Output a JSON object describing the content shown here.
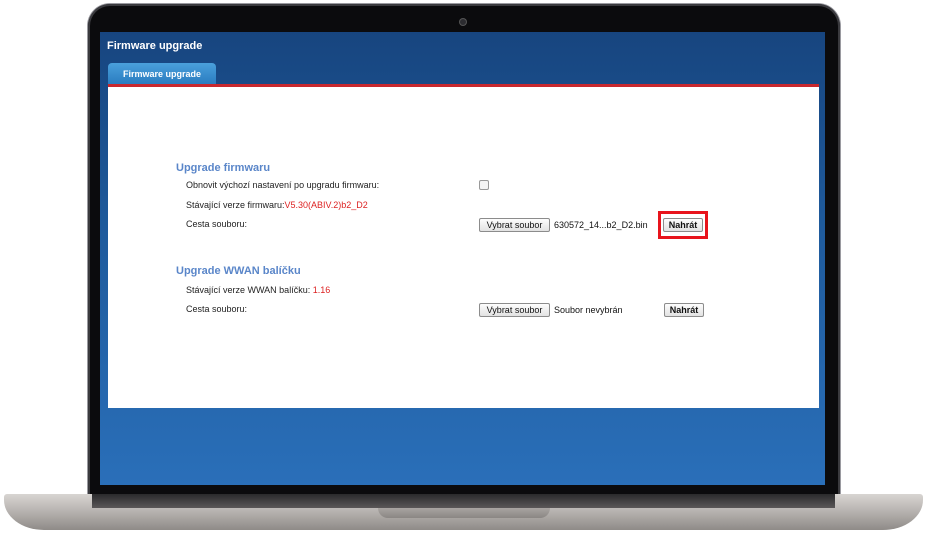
{
  "header": {
    "title": "Firmware upgrade"
  },
  "tabs": [
    {
      "label": "Firmware upgrade",
      "active": true
    }
  ],
  "firmware_section": {
    "title": "Upgrade firmwaru",
    "restore_defaults_label": "Obnovit výchozí nastavení po upgradu firmwaru:",
    "restore_defaults_checked": false,
    "current_version_label": "Stávající verze firmwaru:",
    "current_version_value": "V5.30(ABIV.2)b2_D2",
    "file_path_label": "Cesta souboru:",
    "choose_file_label": "Vybrat soubor",
    "selected_file": "630572_14...b2_D2.bin",
    "upload_label": "Nahrát"
  },
  "wwan_section": {
    "title": "Upgrade WWAN balíčku",
    "current_version_label": "Stávající verze WWAN balíčku:",
    "current_version_value": "1.16",
    "file_path_label": "Cesta souboru:",
    "choose_file_label": "Vybrat soubor",
    "selected_file": "Soubor nevybrán",
    "upload_label": "Nahrát"
  },
  "colors": {
    "accent_blue": "#2a6fb9",
    "tab_blue": "#2a7cc0",
    "section_title": "#5a86c9",
    "value_red": "#dd2222",
    "highlight_red": "#e8141c"
  }
}
